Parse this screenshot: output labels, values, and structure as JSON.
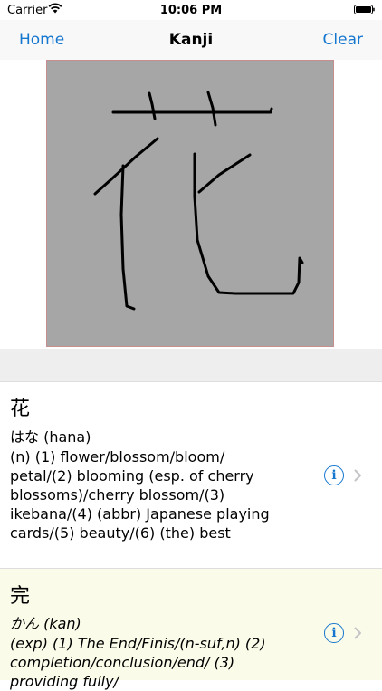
{
  "status_bar": {
    "carrier": "Carrier",
    "time": "10:06 PM"
  },
  "nav": {
    "left": "Home",
    "title": "Kanji",
    "right": "Clear"
  },
  "results": [
    {
      "kanji": "花",
      "reading": "はな (hana)",
      "definition": "(n) (1) flower/blossom/bloom/ petal/(2) blooming (esp. of cherry blossoms)/cherry blossom/(3) ikebana/(4) (abbr) Japanese playing cards/(5) beauty/(6) (the) best"
    },
    {
      "kanji": "完",
      "reading": "かん (kan)",
      "definition": "(exp) (1) The End/Finis/(n-suf,n) (2) completion/conclusion/end/ (3) providing fully/"
    }
  ],
  "colors": {
    "accent": "#1677cf",
    "pad_background": "#a6a6a6",
    "highlight_row": "#fbfbe9"
  }
}
